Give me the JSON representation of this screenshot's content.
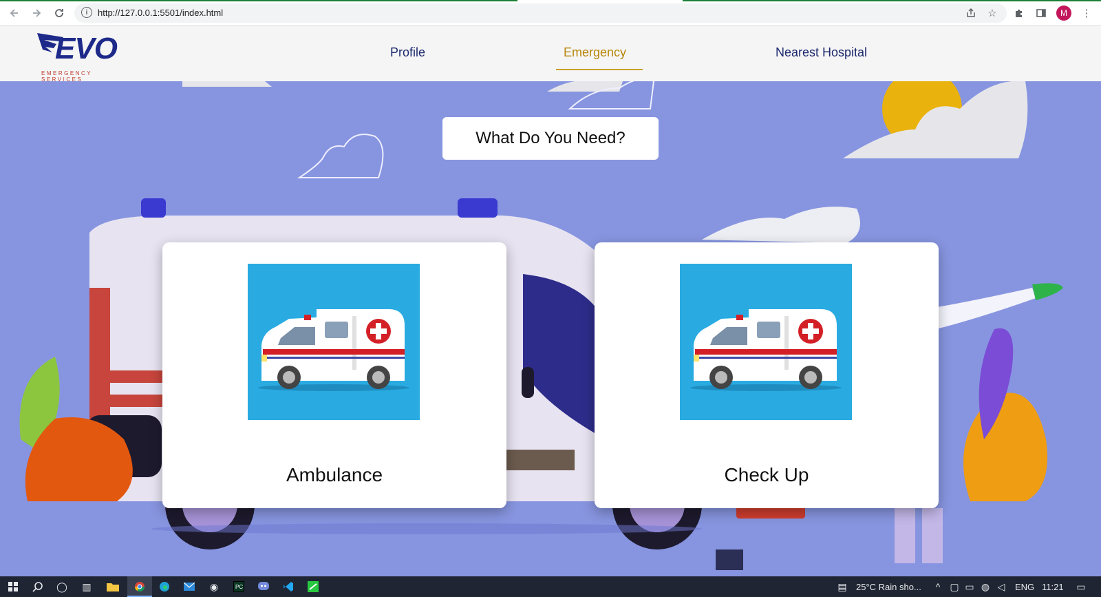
{
  "browser": {
    "url": "http://127.0.0.1:5501/index.html",
    "profile_initial": "M",
    "icons": {
      "back": "arrow-left-icon",
      "forward": "arrow-right-icon",
      "reload": "reload-icon",
      "info": "info-icon",
      "share": "share-icon",
      "bookmark": "star-icon",
      "extensions": "puzzle-icon",
      "sidepanel": "side-panel-icon",
      "menu": "kebab-menu-icon"
    }
  },
  "site": {
    "logo_text": "EVO",
    "logo_tagline": "EMERGENCY SERVICES",
    "nav": [
      {
        "label": "Profile"
      },
      {
        "label": "Emergency"
      },
      {
        "label": "Nearest Hospital"
      }
    ],
    "active_nav": "Emergency",
    "question": "What Do You Need?",
    "cards": [
      {
        "label": "Ambulance",
        "image": "ambulance-illustration"
      },
      {
        "label": "Check Up",
        "image": "ambulance-illustration"
      }
    ]
  },
  "colors": {
    "scene_bg": "#8795e0",
    "nav_text": "#1d2a6e",
    "nav_active": "#b8860b",
    "card_image_bg": "#29abe2",
    "logo": "#1d2a8a"
  },
  "taskbar": {
    "weather": "25°C  Rain sho...",
    "language": "ENG",
    "time": "11:21"
  }
}
